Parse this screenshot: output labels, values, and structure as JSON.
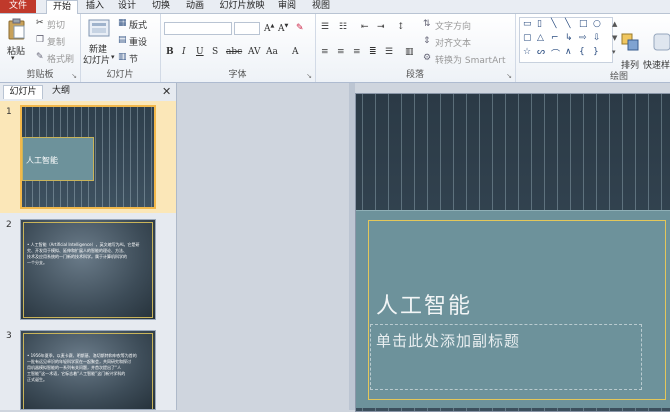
{
  "tabs": [
    "文件",
    "开始",
    "插入",
    "设计",
    "切换",
    "动画",
    "幻灯片放映",
    "审阅",
    "视图"
  ],
  "clipboard": {
    "paste": "粘贴",
    "cut": "剪切",
    "copy": "复制",
    "format_painter": "格式刷",
    "label": "剪贴板"
  },
  "slides_group": {
    "new_slide_line1": "新建",
    "new_slide_line2": "幻灯片",
    "layout": "版式",
    "reset": "重设",
    "section": "节",
    "label": "幻灯片"
  },
  "font_group": {
    "label": "字体"
  },
  "paragraph_group": {
    "text_direction": "文字方向",
    "align_text": "对齐文本",
    "smartart": "转换为 SmartArt",
    "label": "段落"
  },
  "drawing_group": {
    "arrange": "排列",
    "quick_styles": "快速样",
    "label": "绘图"
  },
  "panel": {
    "tab_slides": "幻灯片",
    "tab_outline": "大纲"
  },
  "thumbnails": [
    {
      "number": "1",
      "title": "人工智能"
    },
    {
      "number": "2",
      "text_lines": [
        "• 人工智能（Artificial Intelligence），英文缩写为AI。它是研",
        "  究、开发用于模拟、延伸和扩展人的智能的理论、方法、",
        "  技术及应用系统的一门新的技术科学。属于计算机科学的",
        "  一个分支。"
      ]
    },
    {
      "number": "3",
      "text_lines": [
        "• 1956年夏季，以麦卡赛、明斯基、洛切斯特和申农等为首的",
        "  一批有远见卓识的年轻科学家在一起聚会，共同研究和探讨",
        "  用机器模拟智能的一系列有关问题，并首次提出了“人",
        "  工智能”这一术语，它标志着“人工智能”这门新兴学科的",
        "  正式诞生。"
      ]
    }
  ],
  "main_slide": {
    "title": "人工智能",
    "subtitle_placeholder": "单击此处添加副标题"
  }
}
